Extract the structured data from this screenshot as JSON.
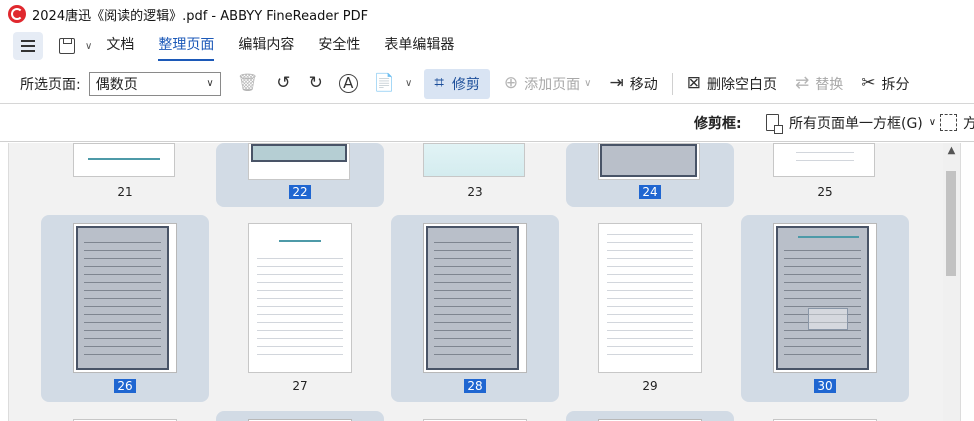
{
  "window": {
    "title": "2024唐迅《阅读的逻辑》.pdf - ABBYY FineReader PDF"
  },
  "menu": {
    "tabs": [
      {
        "label": "文档",
        "active": false
      },
      {
        "label": "整理页面",
        "active": true
      },
      {
        "label": "编辑内容",
        "active": false
      },
      {
        "label": "安全性",
        "active": false
      },
      {
        "label": "表单编辑器",
        "active": false
      }
    ]
  },
  "toolbar": {
    "select_pages_label": "所选页面:",
    "select_pages_value": "偶数页",
    "crop_label": "修剪",
    "add_page_label": "添加页面",
    "move_label": "移动",
    "delete_blank_label": "删除空白页",
    "replace_label": "替换",
    "split_label": "拆分"
  },
  "crop_frame": {
    "label": "修剪框:",
    "mode": "所有页面单一方框(G)",
    "right_cut": "方"
  },
  "thumbnails": {
    "row1": [
      {
        "number": "21",
        "selected": false
      },
      {
        "number": "22",
        "selected": true
      },
      {
        "number": "23",
        "selected": false
      },
      {
        "number": "24",
        "selected": true
      },
      {
        "number": "25",
        "selected": false
      }
    ],
    "row2": [
      {
        "number": "26",
        "selected": true
      },
      {
        "number": "27",
        "selected": false
      },
      {
        "number": "28",
        "selected": true
      },
      {
        "number": "29",
        "selected": false
      },
      {
        "number": "30",
        "selected": true
      }
    ]
  },
  "colors": {
    "accent": "#1c59b8",
    "selection_badge": "#1f66d1",
    "selected_tile": "#d2dbe5",
    "crop_active_bg": "#d9e4f3",
    "app_icon": "#e0282e"
  },
  "icons": [
    "app-logo-icon",
    "menu-icon",
    "save-icon",
    "delete-icon",
    "rotate-left-icon",
    "rotate-right-icon",
    "recognize-icon",
    "page-settings-icon",
    "crop-icon",
    "add-page-icon",
    "move-icon",
    "delete-blank-icon",
    "replace-icon",
    "split-icon",
    "crop-frame-icon",
    "scroll-up-icon"
  ]
}
